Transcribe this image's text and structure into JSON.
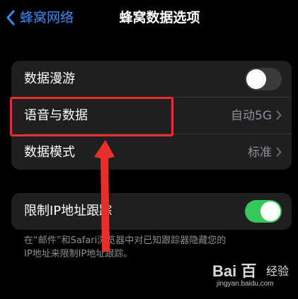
{
  "nav": {
    "back_label": "蜂窝网络",
    "title": "蜂窝数据选项"
  },
  "rows": [
    {
      "label": "数据漫游",
      "control": "toggle",
      "state": "off"
    },
    {
      "label": "语音与数据",
      "value": "自动5G"
    },
    {
      "label": "数据模式",
      "value": "标准"
    }
  ],
  "privacy": {
    "label": "限制IP地址跟踪",
    "state": "on",
    "footer_line1": "在“邮件”和Safari浏览器中对已知跟踪器隐藏您的",
    "footer_line2": "IP地址来限制IP地址跟踪。"
  },
  "watermark": {
    "logo": "Bai 百",
    "jingyan": "经验",
    "url": "jingyan.baidu.com"
  },
  "colors": {
    "accent": "#3b8cf5",
    "toggle_on": "#34c759",
    "highlight": "#e8302a",
    "cell_bg": "#1f1f22"
  }
}
